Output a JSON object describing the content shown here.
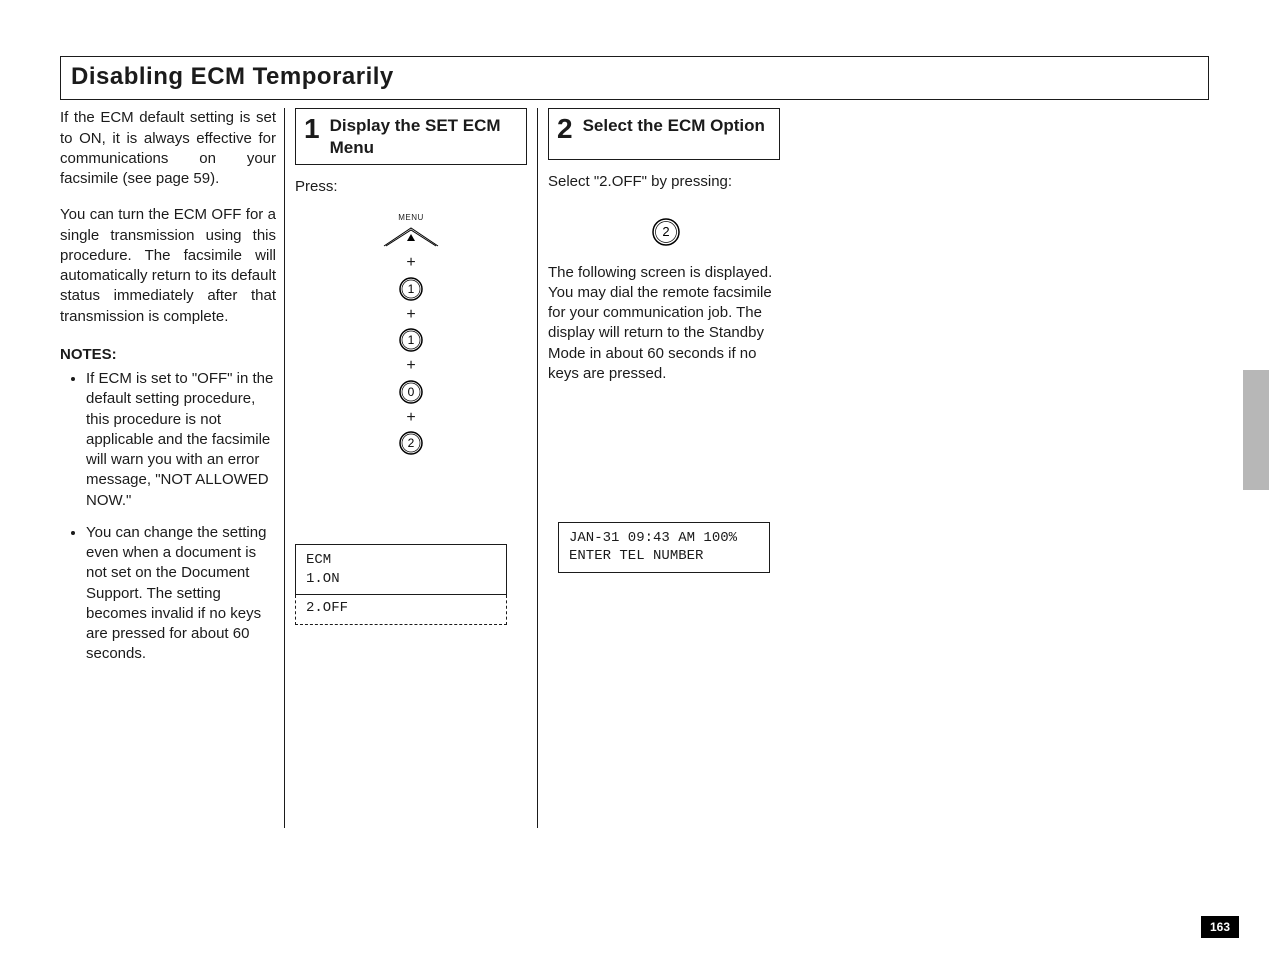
{
  "page_number": "163",
  "section_title": "Disabling  ECM  Temporarily",
  "intro": {
    "p1": "If the ECM default setting is set to ON, it is always effective for communications on your facsimile (see page 59).",
    "p2": "You can turn the ECM OFF for a single transmission using this procedure. The facsimile will automatically return to its default status immediately after that transmission is complete."
  },
  "notes": {
    "heading": "NOTES:",
    "items": [
      "If ECM is set to \"OFF\" in the default setting procedure, this procedure is not applicable and the facsimile will warn you with an error message, \"NOT ALLOWED NOW.\"",
      "You can change the setting even when a document is not set on the Document Support. The setting becomes invalid if no keys are pressed for about 60 seconds."
    ]
  },
  "step1": {
    "num": "1",
    "title": "Display the SET ECM Menu",
    "press_label": "Press:",
    "keys": {
      "menu_label": "MENU",
      "sequence_digits": [
        "1",
        "1",
        "0",
        "2"
      ]
    },
    "lcd_line1": "ECM",
    "lcd_line2": "1.ON",
    "lcd_extra": "2.OFF"
  },
  "step2": {
    "num": "2",
    "title": "Select the ECM Option",
    "select_label": "Select \"2.OFF\" by pressing:",
    "key_digit": "2",
    "result_text": "The following screen is displayed. You may dial the remote facsimile for your communication job. The display will return to the Standby Mode in about 60 seconds if no keys are pressed.",
    "lcd_line1": "JAN-31 09:43 AM 100%",
    "lcd_line2": "ENTER TEL NUMBER"
  }
}
